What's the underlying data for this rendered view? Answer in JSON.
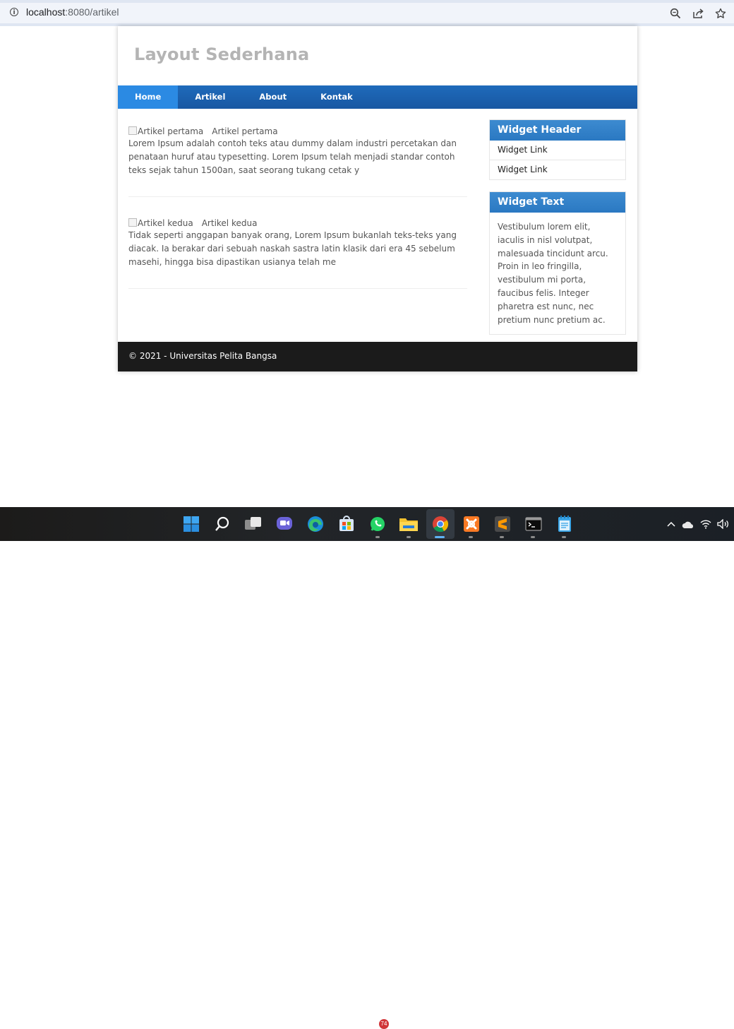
{
  "browser": {
    "url_host": "localhost",
    "url_rest": ":8080/artikel"
  },
  "site": {
    "title": "Layout Sederhana",
    "nav": [
      {
        "label": "Home",
        "active": true
      },
      {
        "label": "Artikel",
        "active": false
      },
      {
        "label": "About",
        "active": false
      },
      {
        "label": "Kontak",
        "active": false
      }
    ]
  },
  "articles": [
    {
      "image_alt": "Artikel pertama",
      "title": "Artikel pertama",
      "excerpt": "Lorem Ipsum adalah contoh teks atau dummy dalam industri percetakan dan penataan huruf atau typesetting. Lorem Ipsum telah menjadi standar contoh teks sejak tahun 1500an, saat seorang tukang cetak y"
    },
    {
      "image_alt": "Artikel kedua",
      "title": "Artikel kedua",
      "excerpt": "Tidak seperti anggapan banyak orang, Lorem Ipsum bukanlah teks-teks yang diacak. Ia berakar dari sebuah naskah sastra latin klasik dari era 45 sebelum masehi, hingga bisa dipastikan usianya telah me"
    }
  ],
  "sidebar": {
    "widget_header": {
      "title": "Widget Header",
      "links": [
        "Widget Link",
        "Widget Link"
      ]
    },
    "widget_text": {
      "title": "Widget Text",
      "body": "Vestibulum lorem elit, iaculis in nisl volutpat, malesuada tincidunt arcu. Proin in leo fringilla, vestibulum mi porta, faucibus felis. Integer pharetra est nunc, nec pretium nunc pretium ac."
    }
  },
  "footer": {
    "text": "© 2021 - Universitas Pelita Bangsa"
  },
  "taskbar": {
    "whatsapp_badge": "74",
    "icons": [
      "windows-start-icon",
      "search-icon",
      "task-view-icon",
      "chat-icon",
      "edge-icon",
      "store-icon",
      "whatsapp-icon",
      "file-explorer-icon",
      "chrome-icon",
      "xampp-icon",
      "sublime-text-icon",
      "terminal-icon",
      "notepad-icon"
    ]
  },
  "colors": {
    "nav_bg": "#1857a2",
    "nav_active": "#2b8ae3",
    "widget_header_bg": "#2b7fc7",
    "footer_bg": "#1b1b1b",
    "site_title": "#b4b4b4"
  }
}
